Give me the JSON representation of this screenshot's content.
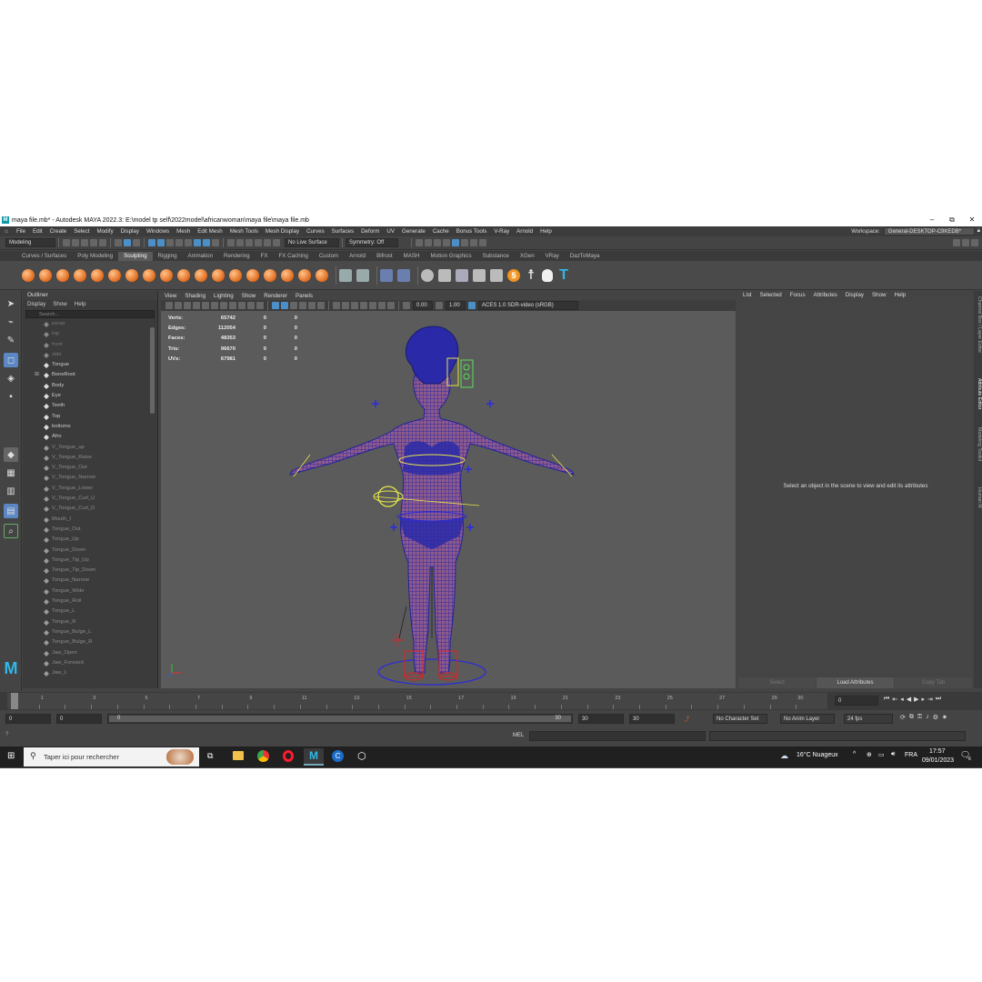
{
  "window": {
    "title": "maya file.mb* - Autodesk MAYA 2022.3: E:\\model tp self\\2022model\\africanwoman\\maya file\\maya file.mb",
    "controls": {
      "minimize": "–",
      "restore": "⧉",
      "close": "✕"
    }
  },
  "menubar": {
    "items": [
      "File",
      "Edit",
      "Create",
      "Select",
      "Modify",
      "Display",
      "Windows",
      "Mesh",
      "Edit Mesh",
      "Mesh Tools",
      "Mesh Display",
      "Curves",
      "Surfaces",
      "Deform",
      "UV",
      "Generate",
      "Cache",
      "Bonus Tools",
      "V-Ray",
      "Arnold",
      "Help"
    ],
    "workspace_label": "Workspace:",
    "workspace_value": "General-DESKTOP-C9KEDB*"
  },
  "statusline": {
    "mode": "Modeling",
    "live_surface": "No Live Surface",
    "symmetry": "Symmetry: Off"
  },
  "shelf": {
    "tabs": [
      "Curves / Surfaces",
      "Poly Modeling",
      "Sculpting",
      "Rigging",
      "Animation",
      "Rendering",
      "FX",
      "FX Caching",
      "Custom",
      "Arnold",
      "Bifrost",
      "MASH",
      "Motion Graphics",
      "Substance",
      "XGen",
      "VRay",
      "DazToMaya"
    ],
    "active_tab": "Sculpting",
    "badge_number": "5"
  },
  "outliner": {
    "title": "Outliner",
    "menu": [
      "Display",
      "Show",
      "Help"
    ],
    "search_placeholder": "Search...",
    "items": [
      {
        "label": "persp",
        "state": "hidden"
      },
      {
        "label": "top",
        "state": "hidden"
      },
      {
        "label": "front",
        "state": "hidden"
      },
      {
        "label": "side",
        "state": "hidden"
      },
      {
        "label": "Tongue",
        "state": "normal"
      },
      {
        "label": "BoneRoot",
        "state": "normal"
      },
      {
        "label": "Body",
        "state": "normal"
      },
      {
        "label": "Eye",
        "state": "normal"
      },
      {
        "label": "Teeth",
        "state": "normal"
      },
      {
        "label": "Top",
        "state": "normal"
      },
      {
        "label": "bottoms",
        "state": "normal"
      },
      {
        "label": "Afro",
        "state": "normal"
      },
      {
        "label": "V_Tongue_up",
        "state": "dim"
      },
      {
        "label": "V_Tongue_Raise",
        "state": "dim"
      },
      {
        "label": "V_Tongue_Out",
        "state": "dim"
      },
      {
        "label": "V_Tongue_Narrow",
        "state": "dim"
      },
      {
        "label": "V_Tongue_Lower",
        "state": "dim"
      },
      {
        "label": "V_Tongue_Curl_U",
        "state": "dim"
      },
      {
        "label": "V_Tongue_Curl_D",
        "state": "dim"
      },
      {
        "label": "Mouth_I",
        "state": "dim"
      },
      {
        "label": "Tongue_Out",
        "state": "dim"
      },
      {
        "label": "Tongue_Up",
        "state": "dim"
      },
      {
        "label": "Tongue_Down",
        "state": "dim"
      },
      {
        "label": "Tongue_Tip_Up",
        "state": "dim"
      },
      {
        "label": "Tongue_Tip_Down",
        "state": "dim"
      },
      {
        "label": "Tongue_Narrow",
        "state": "dim"
      },
      {
        "label": "Tongue_Wide",
        "state": "dim"
      },
      {
        "label": "Tongue_Roll",
        "state": "dim"
      },
      {
        "label": "Tongue_L",
        "state": "dim"
      },
      {
        "label": "Tongue_R",
        "state": "dim"
      },
      {
        "label": "Tongue_Bulge_L",
        "state": "dim"
      },
      {
        "label": "Tongue_Bulge_R",
        "state": "dim"
      },
      {
        "label": "Jaw_Open",
        "state": "dim"
      },
      {
        "label": "Jaw_Forward",
        "state": "dim"
      },
      {
        "label": "Jaw_L",
        "state": "dim"
      }
    ]
  },
  "viewport": {
    "menu": [
      "View",
      "Shading",
      "Lighting",
      "Show",
      "Renderer",
      "Panels"
    ],
    "exposure": "0.00",
    "gamma": "1.00",
    "color_space": "ACES 1.0 SDR-video (sRGB)",
    "hud": [
      {
        "label": "Verts:",
        "value": "65742",
        "a": "0",
        "b": "0"
      },
      {
        "label": "Edges:",
        "value": "112054",
        "a": "0",
        "b": "0"
      },
      {
        "label": "Faces:",
        "value": "48353",
        "a": "0",
        "b": "0"
      },
      {
        "label": "Tris:",
        "value": "96670",
        "a": "0",
        "b": "0"
      },
      {
        "label": "UVs:",
        "value": "67981",
        "a": "0",
        "b": "0"
      }
    ]
  },
  "attribute_editor": {
    "menu": [
      "List",
      "Selected",
      "Focus",
      "Attributes",
      "Display",
      "Show",
      "Help"
    ],
    "message": "Select an object in the scene to view and edit its attributes",
    "buttons": [
      "Select",
      "Load Attributes",
      "Copy Tab"
    ]
  },
  "side_tabs": [
    "Channel Box / Layer Editor",
    "Attribute Editor",
    "Modeling Toolkit",
    "Human IK"
  ],
  "timeline": {
    "ticks": [
      "0",
      "1",
      "3",
      "5",
      "7",
      "9",
      "11",
      "13",
      "15",
      "17",
      "19",
      "21",
      "23",
      "25",
      "27",
      "29",
      "30"
    ],
    "current_frame": "0"
  },
  "range": {
    "start": "0",
    "playback_start": "0",
    "slider_start": "0",
    "slider_end": "30",
    "playback_end": "30",
    "end": "30",
    "character_set": "No Character Set",
    "anim_layer": "No Anim Layer",
    "fps": "24 fps"
  },
  "command_line": {
    "language": "MEL"
  },
  "taskbar": {
    "search_placeholder": "Taper ici pour rechercher",
    "weather": "16°C  Nuageux",
    "language": "FRA",
    "time": "17:57",
    "date": "09/01/2023",
    "notifications": "6"
  },
  "colors": {
    "accent": "#5b87c4",
    "mesh_wire": "#2a2aa8",
    "mesh_fill": "#8e5a8a",
    "ctrl_yellow": "#e6e64a",
    "ctrl_blue": "#3a3ad8"
  }
}
